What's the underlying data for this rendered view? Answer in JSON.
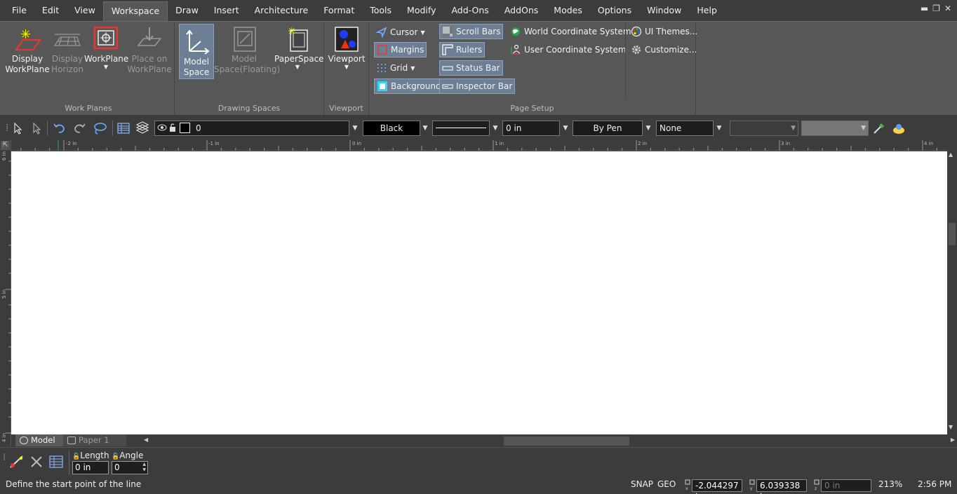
{
  "menu": {
    "items": [
      "File",
      "Edit",
      "View",
      "Workspace",
      "Draw",
      "Insert",
      "Architecture",
      "Format",
      "Tools",
      "Modify",
      "Add-Ons",
      "AddOns",
      "Modes",
      "Options",
      "Window",
      "Help"
    ],
    "active": "Workspace"
  },
  "ribbon": {
    "work_planes": {
      "label": "Work Planes",
      "display_workplane": "Display\nWorkPlane",
      "display_horizon": "Display\nHorizon",
      "workplane": "WorkPlane",
      "place_on_workplane": "Place on\nWorkPlane"
    },
    "drawing_spaces": {
      "label": "Drawing Spaces",
      "model_space": "Model\nSpace",
      "model_space_floating": "Model\nSpace(Floating)",
      "paperspace": "PaperSpace"
    },
    "viewport": {
      "label": "Viewport",
      "viewport": "Viewport"
    },
    "page_setup": {
      "label": "Page Setup",
      "cursor": "Cursor",
      "margins": "Margins",
      "grid": "Grid",
      "background": "Background",
      "scroll_bars": "Scroll Bars",
      "rulers": "Rulers",
      "status_bar": "Status Bar",
      "inspector_bar": "Inspector Bar",
      "world_cs": "World Coordinate System",
      "user_cs": "User Coordinate System"
    },
    "ui": {
      "themes": "UI Themes...",
      "customize": "Customize..."
    }
  },
  "propbar": {
    "layer_value": "0",
    "color_value": "Black",
    "thickness_value": "0 in",
    "pen_value": "By Pen",
    "fill_value": "None"
  },
  "rulers": {
    "h_ticks": [
      "-2 in",
      "-1 in",
      "0 in",
      "1 in",
      "2 in",
      "3 in",
      "4 in"
    ],
    "v_ticks": [
      "6 in",
      "5 in",
      "4 in"
    ]
  },
  "tabs": {
    "model": "Model",
    "paper1": "Paper 1"
  },
  "inspector": {
    "length_label": "Length",
    "length_value": "0 in",
    "angle_label": "Angle",
    "angle_value": "0"
  },
  "status": {
    "prompt": "Define the start point of the line",
    "snap": "SNAP",
    "geo": "GEO",
    "x_value": "-2.044297 in",
    "y_value": "6.039338 in",
    "z_value": "0 in",
    "zoom": "213%",
    "time": "2:56 PM"
  },
  "colors": {
    "accent": "#6d7f95",
    "ribbon_bg": "#575757",
    "app_bg": "#3c3c3c"
  }
}
